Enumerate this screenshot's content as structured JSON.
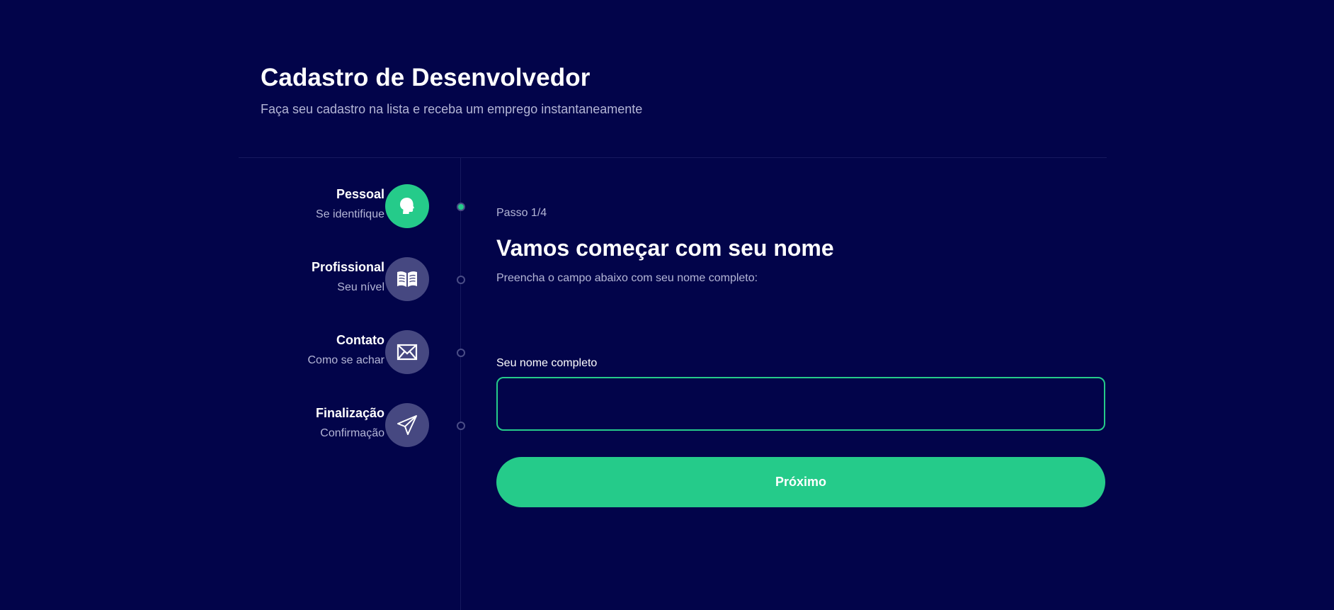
{
  "header": {
    "title": "Cadastro de Desenvolvedor",
    "subtitle": "Faça seu cadastro na lista e receba um emprego instantaneamente"
  },
  "steps": [
    {
      "title": "Pessoal",
      "subtitle": "Se identifique",
      "icon": "person-head-icon",
      "active": true
    },
    {
      "title": "Profissional",
      "subtitle": "Seu nível",
      "icon": "book-icon",
      "active": false
    },
    {
      "title": "Contato",
      "subtitle": "Como se achar",
      "icon": "mail-icon",
      "active": false
    },
    {
      "title": "Finalização",
      "subtitle": "Confirmação",
      "icon": "send-icon",
      "active": false
    }
  ],
  "form": {
    "step_counter": "Passo 1/4",
    "heading": "Vamos começar com seu nome",
    "description": "Preencha o campo abaixo com seu nome completo:",
    "name_label": "Seu nome completo",
    "name_value": "",
    "next_label": "Próximo"
  },
  "colors": {
    "background": "#02044a",
    "accent": "#25cb8a",
    "inactive_circle": "#464881",
    "muted_text": "#b4b6d6"
  }
}
